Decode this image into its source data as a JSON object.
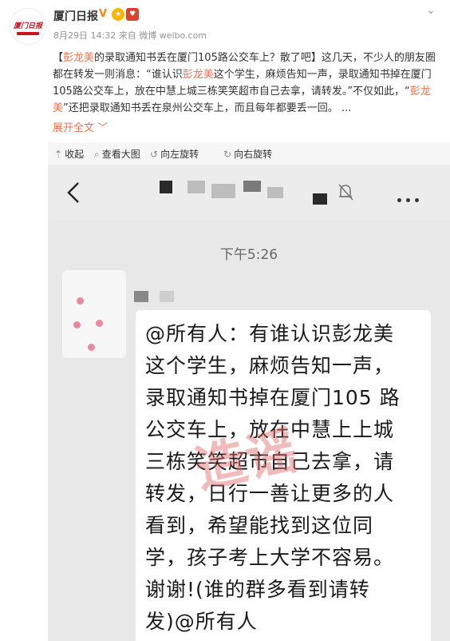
{
  "account": {
    "name": "厦门日报",
    "verified_mark": "V",
    "logo_text": "厦门日报"
  },
  "meta": {
    "date": "8月29日",
    "time": "14:32",
    "source": "来自 微博 weibo.com"
  },
  "post": {
    "segments": [
      {
        "text": "【",
        "color": "#333333"
      },
      {
        "text": "彭龙美",
        "color": "#eb7350"
      },
      {
        "text": "的录取通知书丢在厦门105路公交车上？散了吧】这几天，不少人的朋友圈都在转发一则消息：“谁认识",
        "color": "#333333"
      },
      {
        "text": "彭龙美",
        "color": "#eb7350"
      },
      {
        "text": "这个学生，麻烦告知一声，录取通知书掉在厦门105路公交车上，放在中慧上城三栋笑笑超市自己去拿，请转发。”不仅如此，“",
        "color": "#333333"
      },
      {
        "text": "彭龙美",
        "color": "#eb7350"
      },
      {
        "text": "”还把录取通知书丢在泉州公交车上，而且每年都要丢一回。 ...",
        "color": "#333333"
      }
    ],
    "expand_label": "展开全文 ﹀"
  },
  "toolbar": {
    "collapse": "收起",
    "view_large": "查看大图",
    "rotate_left": "向左旋转",
    "rotate_right": "向右旋转"
  },
  "chat": {
    "time": "下午5:26",
    "message": "@所有人：有谁认识彭龙美这个学生，麻烦告知一声，录取通知书掉在厦门105 路公交车上，放在中慧上上城三栋笑笑超市自己去拿，请转发，日行一善让更多的人看到，希望能找到这位同学，孩子考上大学不容易。谢谢!(谁的群多看到请转发)@所有人",
    "watermark": "造谣"
  },
  "colors": {
    "accent": "#eb7350",
    "verified": "#ff8200",
    "brand_red": "#c9151e"
  }
}
